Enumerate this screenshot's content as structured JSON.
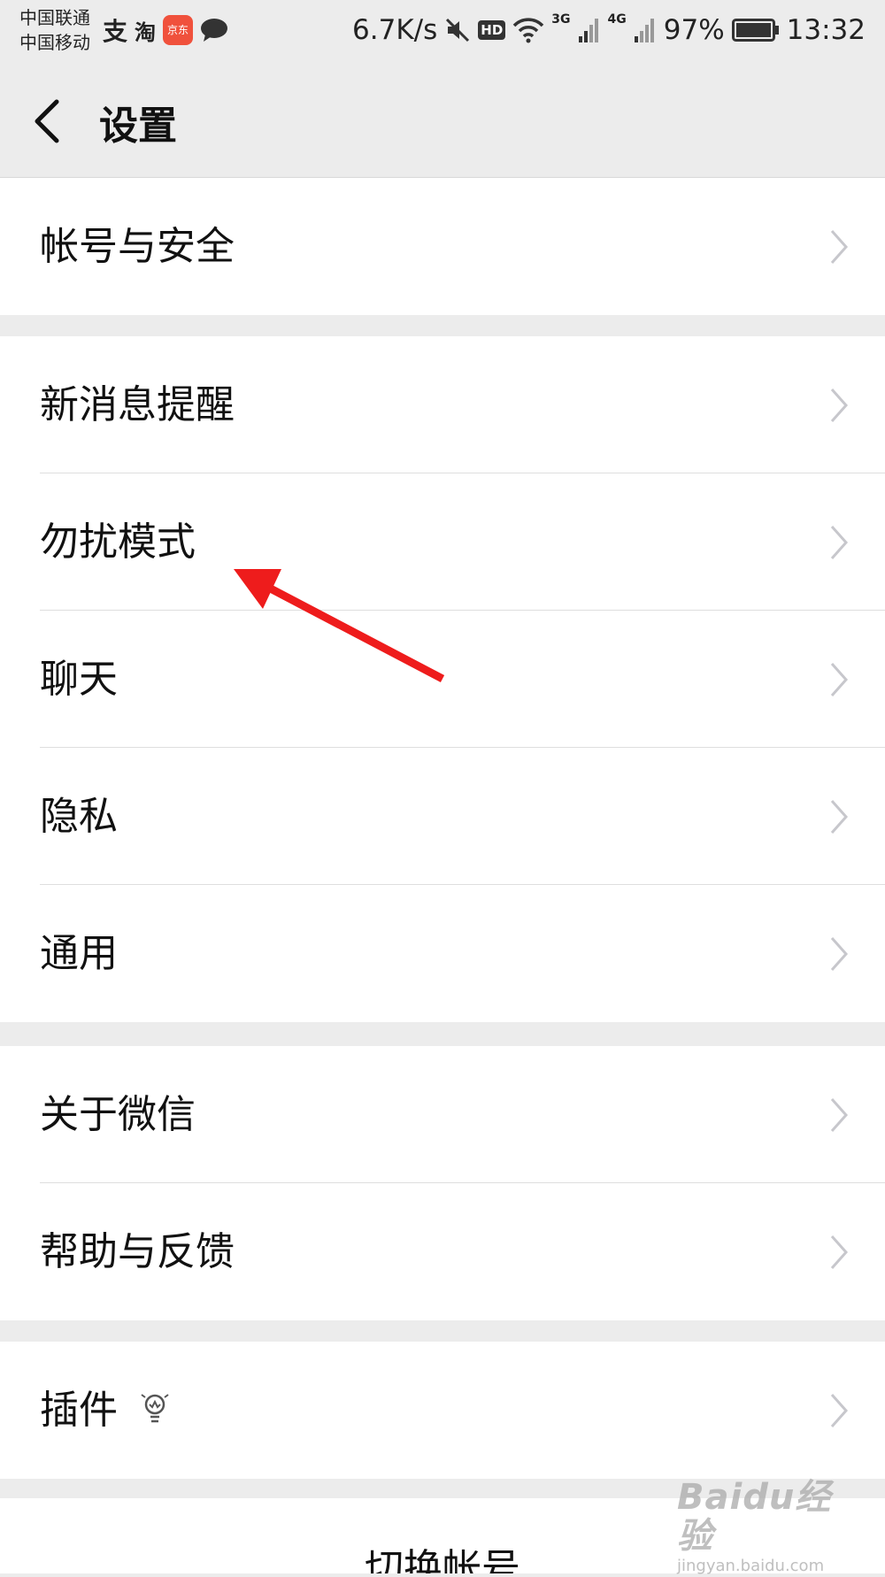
{
  "status_bar": {
    "carrier_1": "中国联通",
    "carrier_2": "中国移动",
    "notif_alipay": "支",
    "notif_taobao": "淘",
    "notif_jd": "京东",
    "net_speed": "6.7K/s",
    "hd_label": "HD",
    "net_3g": "3G",
    "net_4g": "4G",
    "battery": "97%",
    "time": "13:32"
  },
  "header": {
    "title": "设置"
  },
  "groups": {
    "g1": {
      "items": [
        {
          "label": "帐号与安全"
        }
      ]
    },
    "g2": {
      "items": [
        {
          "label": "新消息提醒"
        },
        {
          "label": "勿扰模式"
        },
        {
          "label": "聊天"
        },
        {
          "label": "隐私"
        },
        {
          "label": "通用"
        }
      ]
    },
    "g3": {
      "items": [
        {
          "label": "关于微信"
        },
        {
          "label": "帮助与反馈"
        }
      ]
    },
    "g4": {
      "items": [
        {
          "label": "插件"
        }
      ]
    },
    "g5": {
      "items": [
        {
          "label": "切换帐号"
        }
      ]
    }
  },
  "watermark": {
    "brand": "Baidu经验",
    "url": "jingyan.baidu.com"
  },
  "colors": {
    "background": "#ececec",
    "cell": "#ffffff",
    "annotation_arrow": "#ee1c1c",
    "chevron": "#c7c7cc"
  },
  "icons": [
    "chevron-left-icon",
    "chevron-right-icon",
    "lightbulb-icon",
    "mute-icon",
    "wifi-icon",
    "signal-icon",
    "battery-icon",
    "chat-bubble-icon"
  ]
}
